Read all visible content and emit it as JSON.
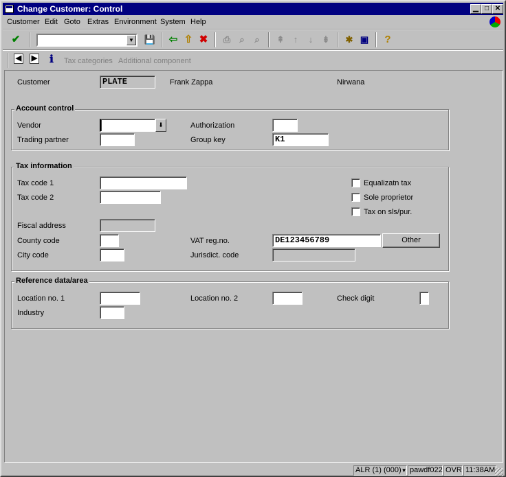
{
  "window": {
    "title": "Change Customer: Control",
    "min_symbol": "▁",
    "max_symbol": "□",
    "close_symbol": "✕"
  },
  "menu": [
    "Customer",
    "Edit",
    "Goto",
    "Extras",
    "Environment",
    "System",
    "Help"
  ],
  "system_toolbar": {
    "enter_symbol": "✔",
    "command_value": "",
    "icons": {
      "save": "💾",
      "back": "⇦",
      "exit": "⇧",
      "cancel": "✖",
      "print": "⎙",
      "find": "⌕",
      "find_next": "⌕",
      "first_page": "⇞",
      "prev_page": "↑",
      "next_page": "↓",
      "last_page": "⇟",
      "create_session": "✱",
      "shortcut": "▣",
      "help": "?"
    }
  },
  "app_toolbar": {
    "prev_icon": "◀",
    "next_icon": "▶",
    "info_icon": "ℹ",
    "tax_categories": "Tax categories",
    "additional_component": "Additional component"
  },
  "header": {
    "customer_label": "Customer",
    "customer_value": "PLATE",
    "name": "Frank Zappa",
    "city": "Nirwana"
  },
  "account_control": {
    "title": "Account control",
    "vendor_label": "Vendor",
    "vendor_value": "",
    "vendor_dropdown": "⬇",
    "authorization_label": "Authorization",
    "authorization_value": "",
    "trading_partner_label": "Trading partner",
    "trading_partner_value": "",
    "group_key_label": "Group key",
    "group_key_value": "K1"
  },
  "tax_information": {
    "title": "Tax information",
    "tax_code_1_label": "Tax code 1",
    "tax_code_1_value": "",
    "tax_code_2_label": "Tax code 2",
    "tax_code_2_value": "",
    "fiscal_address_label": "Fiscal address",
    "fiscal_address_value": "",
    "county_code_label": "County code",
    "county_code_value": "",
    "city_code_label": "City code",
    "city_code_value": "",
    "vat_reg_label": "VAT reg.no.",
    "vat_reg_value": "DE123456789",
    "other_button": "Other",
    "jurisdict_label": "Jurisdict. code",
    "jurisdict_value": "",
    "equalization_tax_label": "Equalizatn tax",
    "equalization_tax_checked": false,
    "sole_proprietor_label": "Sole proprietor",
    "sole_proprietor_checked": false,
    "tax_on_sls_label": "Tax on sls/pur.",
    "tax_on_sls_checked": false
  },
  "reference_data": {
    "title": "Reference data/area",
    "location_1_label": "Location no. 1",
    "location_1_value": "",
    "location_2_label": "Location no. 2",
    "location_2_value": "",
    "check_digit_label": "Check digit",
    "check_digit_value": "",
    "industry_label": "Industry",
    "industry_value": ""
  },
  "status": {
    "system": "ALR (1) (000)",
    "dropdown": "▼",
    "server": "pawdf022",
    "mode": "OVR",
    "time": "11:38AM"
  }
}
